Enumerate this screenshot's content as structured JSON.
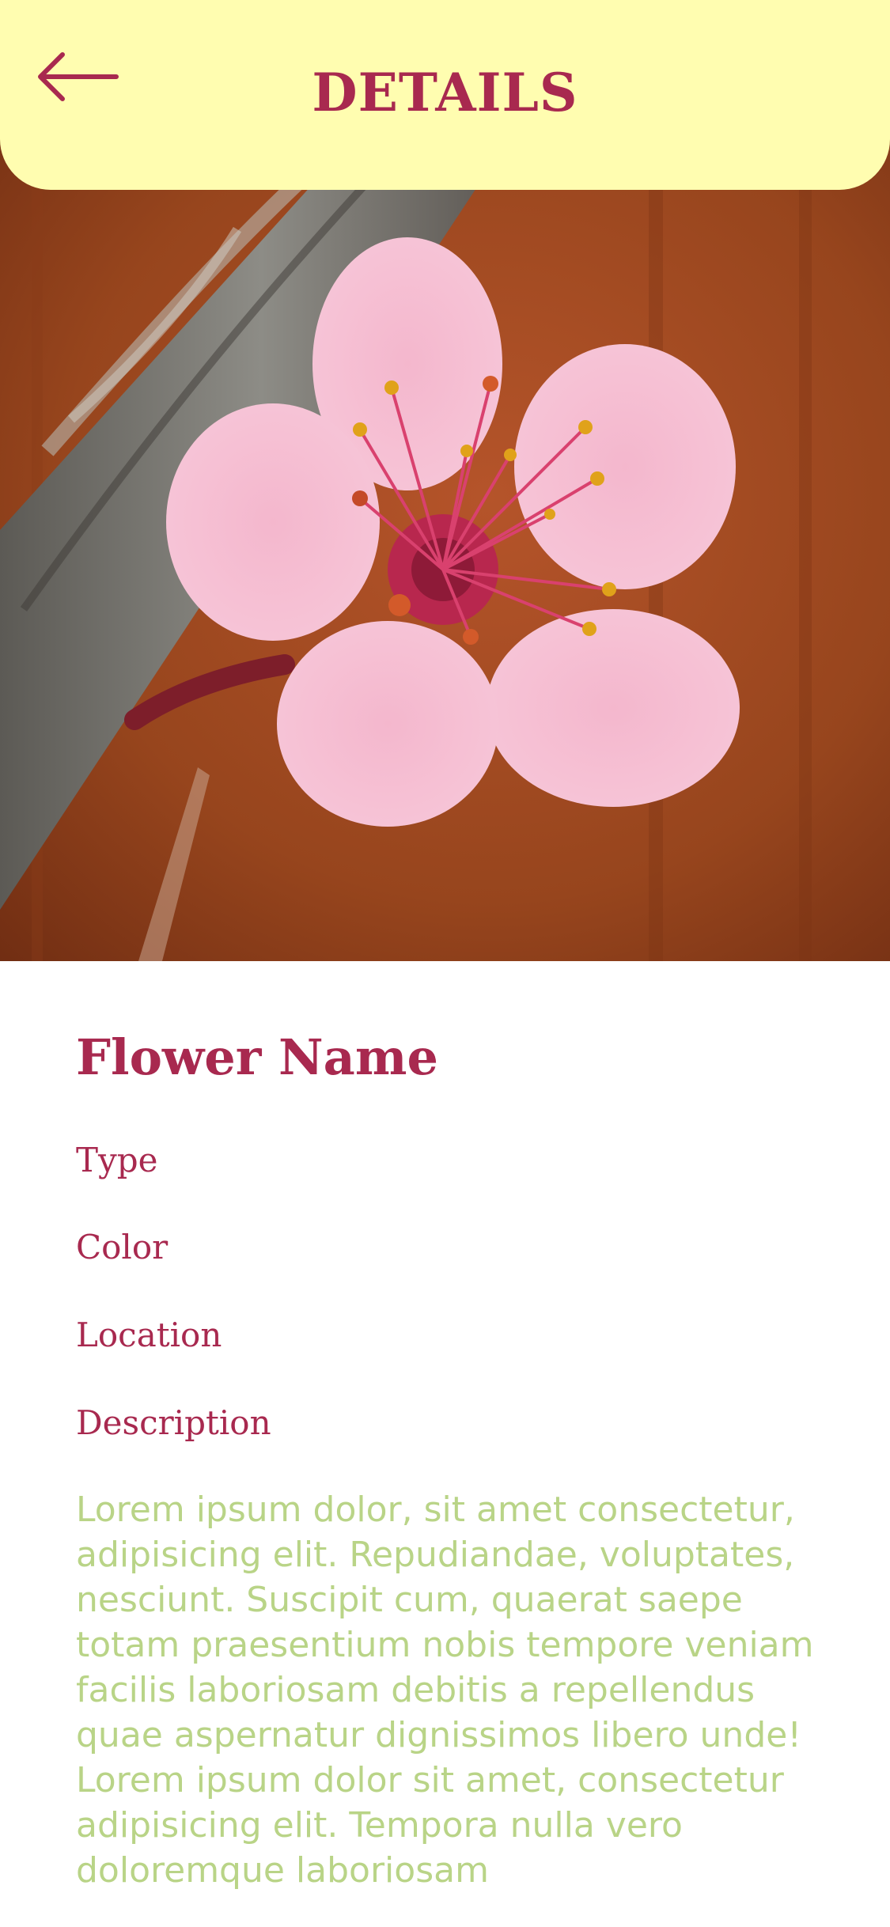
{
  "header": {
    "title": "DETAILS",
    "back_icon": "arrow-left-icon"
  },
  "hero": {
    "image": "pink-blossom-photo"
  },
  "details": {
    "name": "Flower Name",
    "type_label": "Type",
    "color_label": "Color",
    "location_label": "Location",
    "description_label": "Description",
    "description_text": "Lorem ipsum dolor, sit amet consectetur, adipisicing elit. Repudiandae, voluptates, nesciunt. Suscipit cum, quaerat saepe totam praesentium nobis tempore veniam facilis laboriosam debitis a repellendus quae aspernatur dignissimos libero unde! Lorem ipsum dolor sit amet, consectetur adipisicing elit. Tempora nulla vero doloremque laboriosam"
  },
  "colors": {
    "header_bg": "#FFFDB0",
    "accent": "#A8294F",
    "body_text": "#B9D487"
  }
}
